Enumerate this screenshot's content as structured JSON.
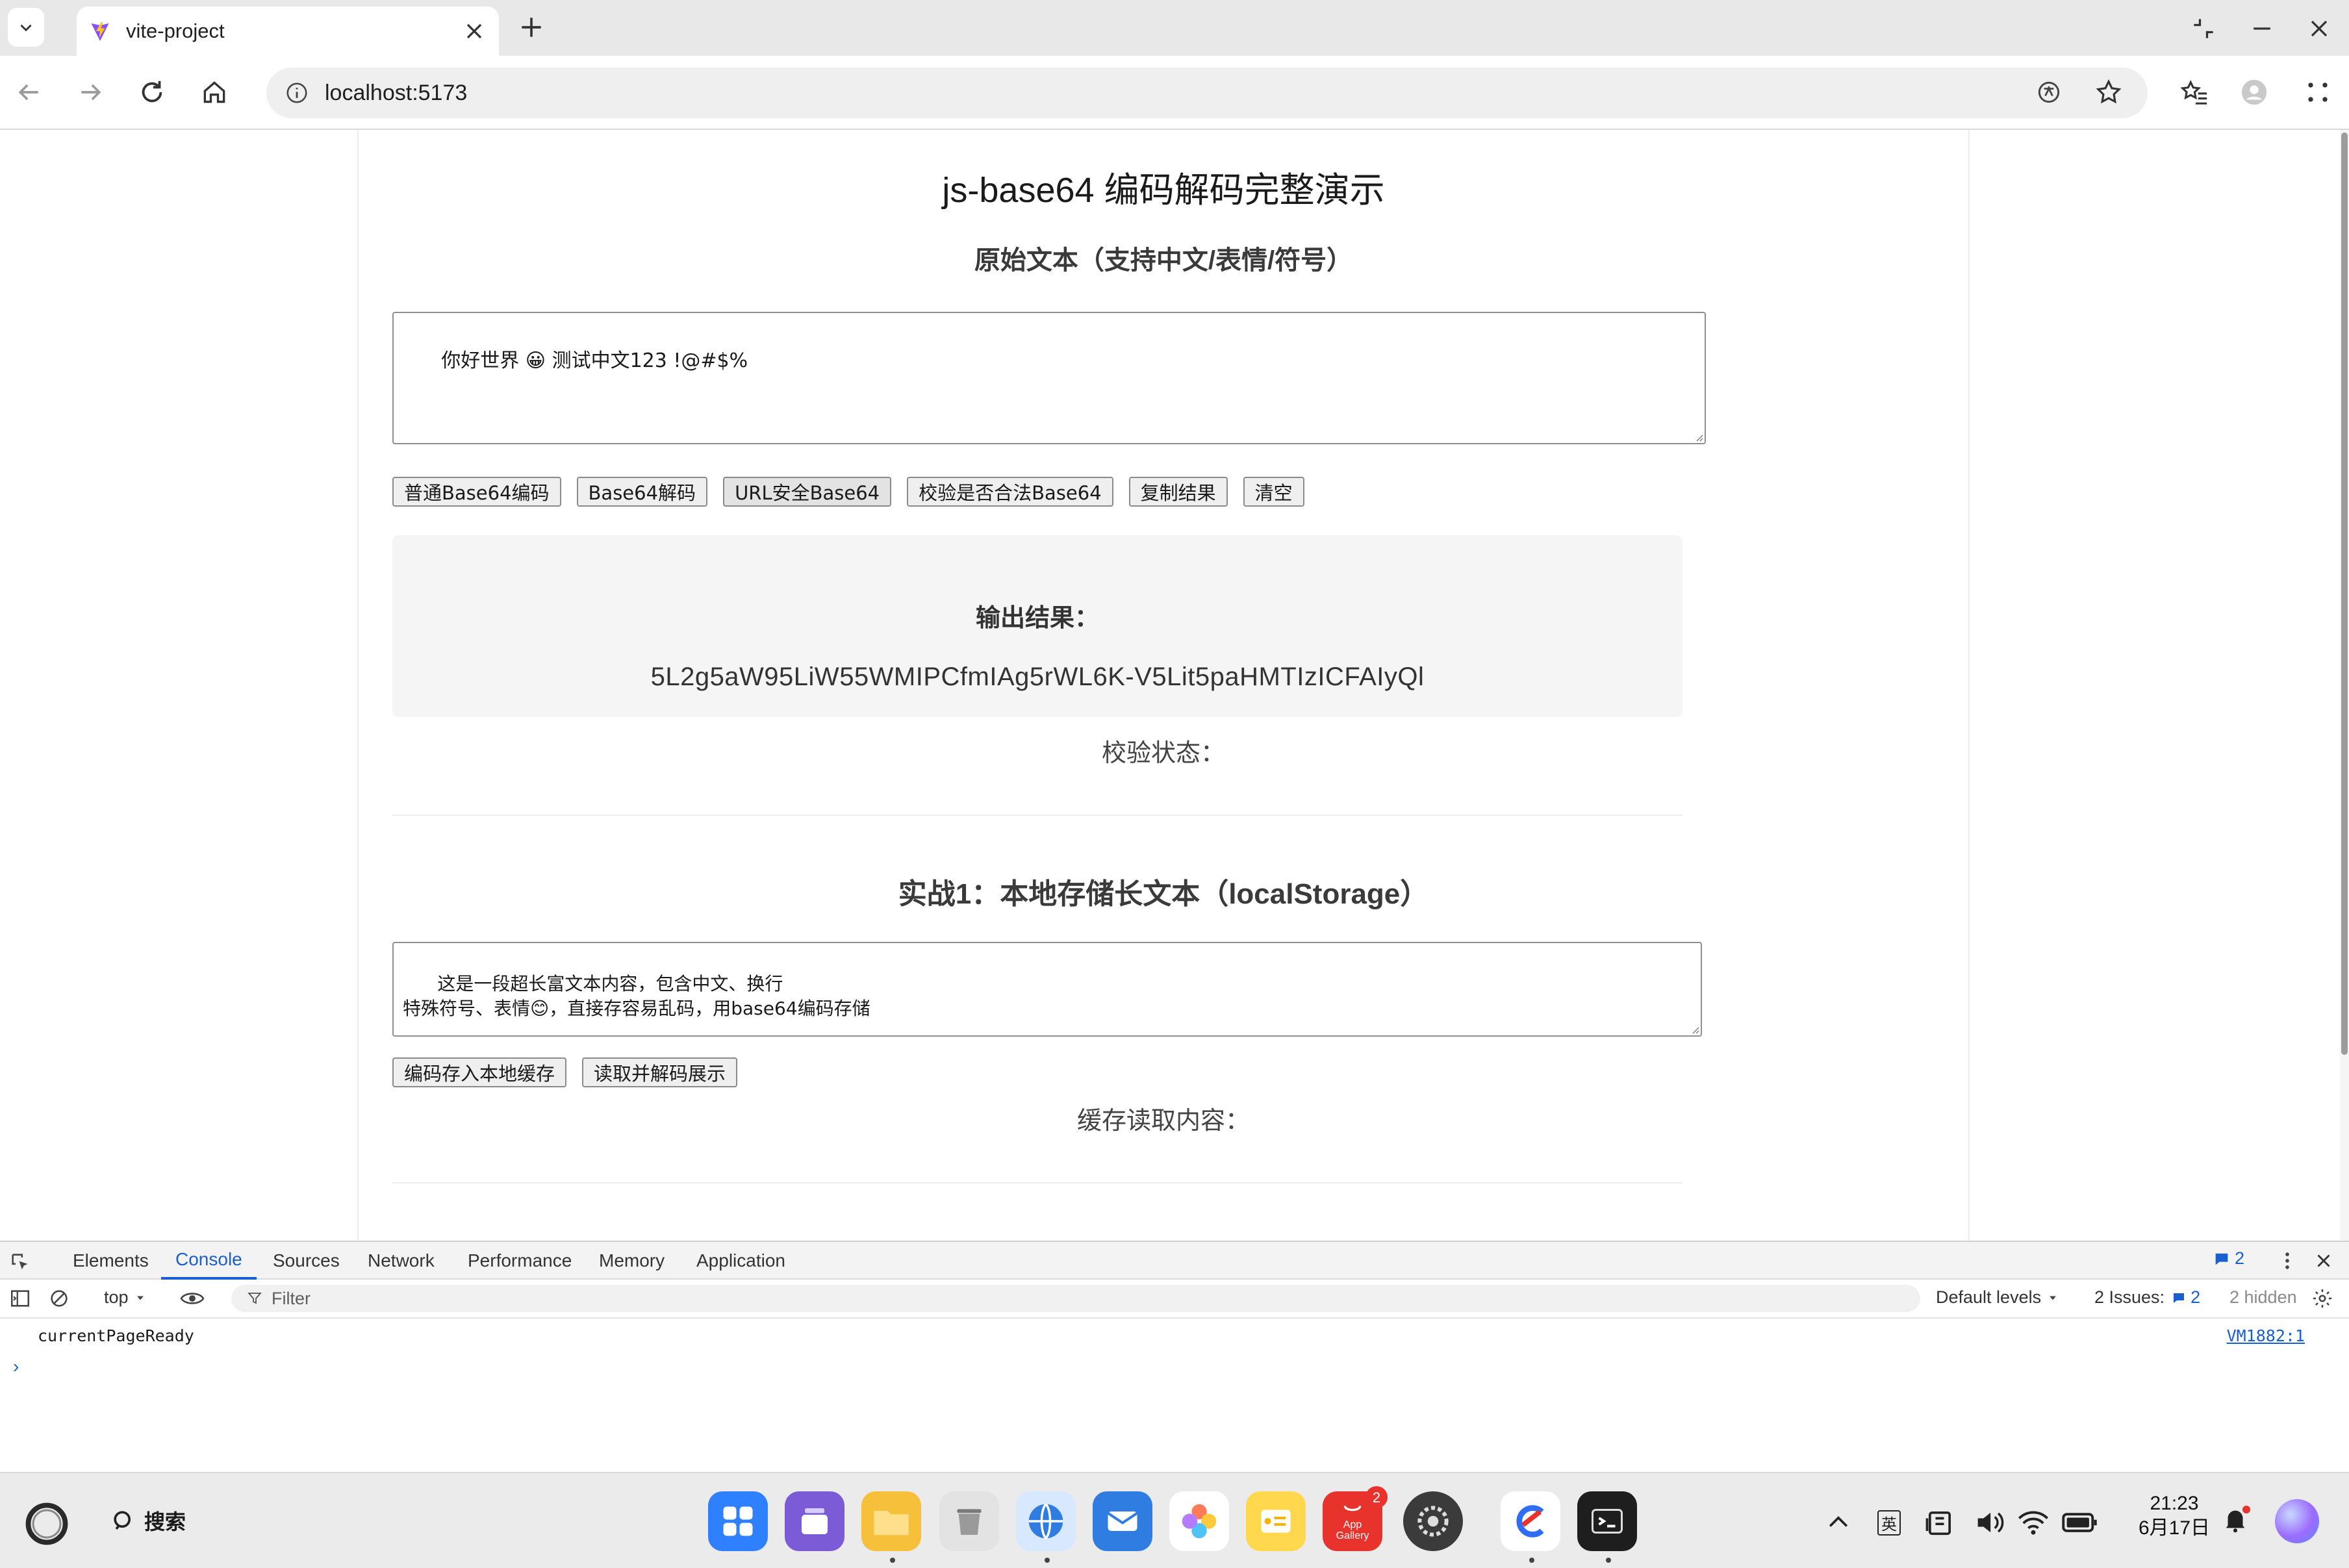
{
  "browser": {
    "tab_title": "vite-project",
    "url": "localhost:5173"
  },
  "page": {
    "title": "js-base64 编码解码完整演示",
    "input_heading": "原始文本（支持中文/表情/符号）",
    "input_value": "你好世界 😀 测试中文123 !@#$%",
    "buttons": {
      "encode": "普通Base64编码",
      "decode": "Base64解码",
      "url_safe": "URL安全Base64",
      "validate": "校验是否合法Base64",
      "copy": "复制结果",
      "clear": "清空"
    },
    "result_label": "输出结果：",
    "result_value": "5L2g5aW95LiW55WMIPCfmIAg5rWL6K-V5Lit5paHMTIzICFAIyQl",
    "status_label": "校验状态：",
    "practice_heading": "实战1：本地存储长文本（localStorage）",
    "practice_value": "这是一段超长富文本内容，包含中文、换行\n特殊符号、表情😊，直接存容易乱码，用base64编码存储",
    "practice_buttons": {
      "save": "编码存入本地缓存",
      "load": "读取并解码展示"
    },
    "cache_label": "缓存读取内容："
  },
  "devtools": {
    "tabs": [
      "Elements",
      "Console",
      "Sources",
      "Network",
      "Performance",
      "Memory",
      "Application"
    ],
    "active_tab": "Console",
    "message_count": "2",
    "context": "top",
    "filter_placeholder": "Filter",
    "levels": "Default levels",
    "issues_label": "2 Issues:",
    "issues_count": "2",
    "hidden": "2 hidden",
    "console_message": "currentPageReady",
    "console_source": "VM1882:1"
  },
  "taskbar": {
    "search_label": "搜索",
    "app_gallery_label": "App Gallery",
    "app_gallery_badge": "2",
    "ime": "英",
    "ime_box": "英",
    "time": "21:23",
    "date": "6月17日"
  },
  "colors": {
    "accent": "#1a5fd0",
    "vite_purple": "#8a4dff",
    "vite_yellow": "#ffc517",
    "badge_red": "#e8322c"
  }
}
